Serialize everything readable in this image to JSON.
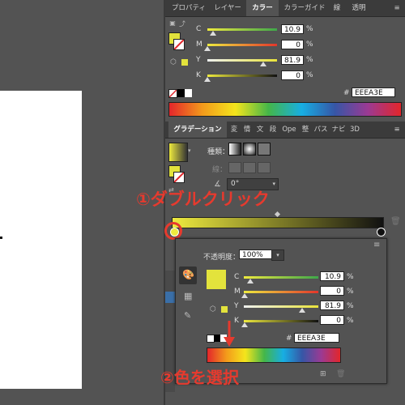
{
  "color_panel": {
    "tabs": [
      "プロパティ",
      "レイヤー",
      "カラー",
      "カラーガイド",
      "線",
      "透明"
    ],
    "rows": [
      {
        "label": "C",
        "value": "10.9",
        "unit": "%"
      },
      {
        "label": "M",
        "value": "0",
        "unit": "%"
      },
      {
        "label": "Y",
        "value": "81.9",
        "unit": "%"
      },
      {
        "label": "K",
        "value": "0",
        "unit": "%"
      }
    ],
    "hex_label": "#",
    "hex_value": "EEEA3E"
  },
  "gradient_panel": {
    "tabs": [
      "グラデーション",
      "変",
      "情",
      "文",
      "段",
      "Ope",
      "整",
      "パス",
      "ナビ",
      "3D"
    ],
    "type_label": "種類：",
    "stroke_label": "線：",
    "angle_value": "0°"
  },
  "popup": {
    "opacity_label": "不透明度：",
    "opacity_value": "100%",
    "rows": [
      {
        "label": "C",
        "value": "10.9",
        "unit": "%"
      },
      {
        "label": "M",
        "value": "0",
        "unit": "%"
      },
      {
        "label": "Y",
        "value": "81.9",
        "unit": "%"
      },
      {
        "label": "K",
        "value": "0",
        "unit": "%"
      }
    ],
    "hex_label": "#",
    "hex_value": "EEEA3E"
  },
  "annotations": {
    "double_click": "①ダブルクリック",
    "select_color": "②色を選択"
  },
  "colors": {
    "selected_color": "#e3e33c",
    "callout_red": "#e63a2e"
  }
}
